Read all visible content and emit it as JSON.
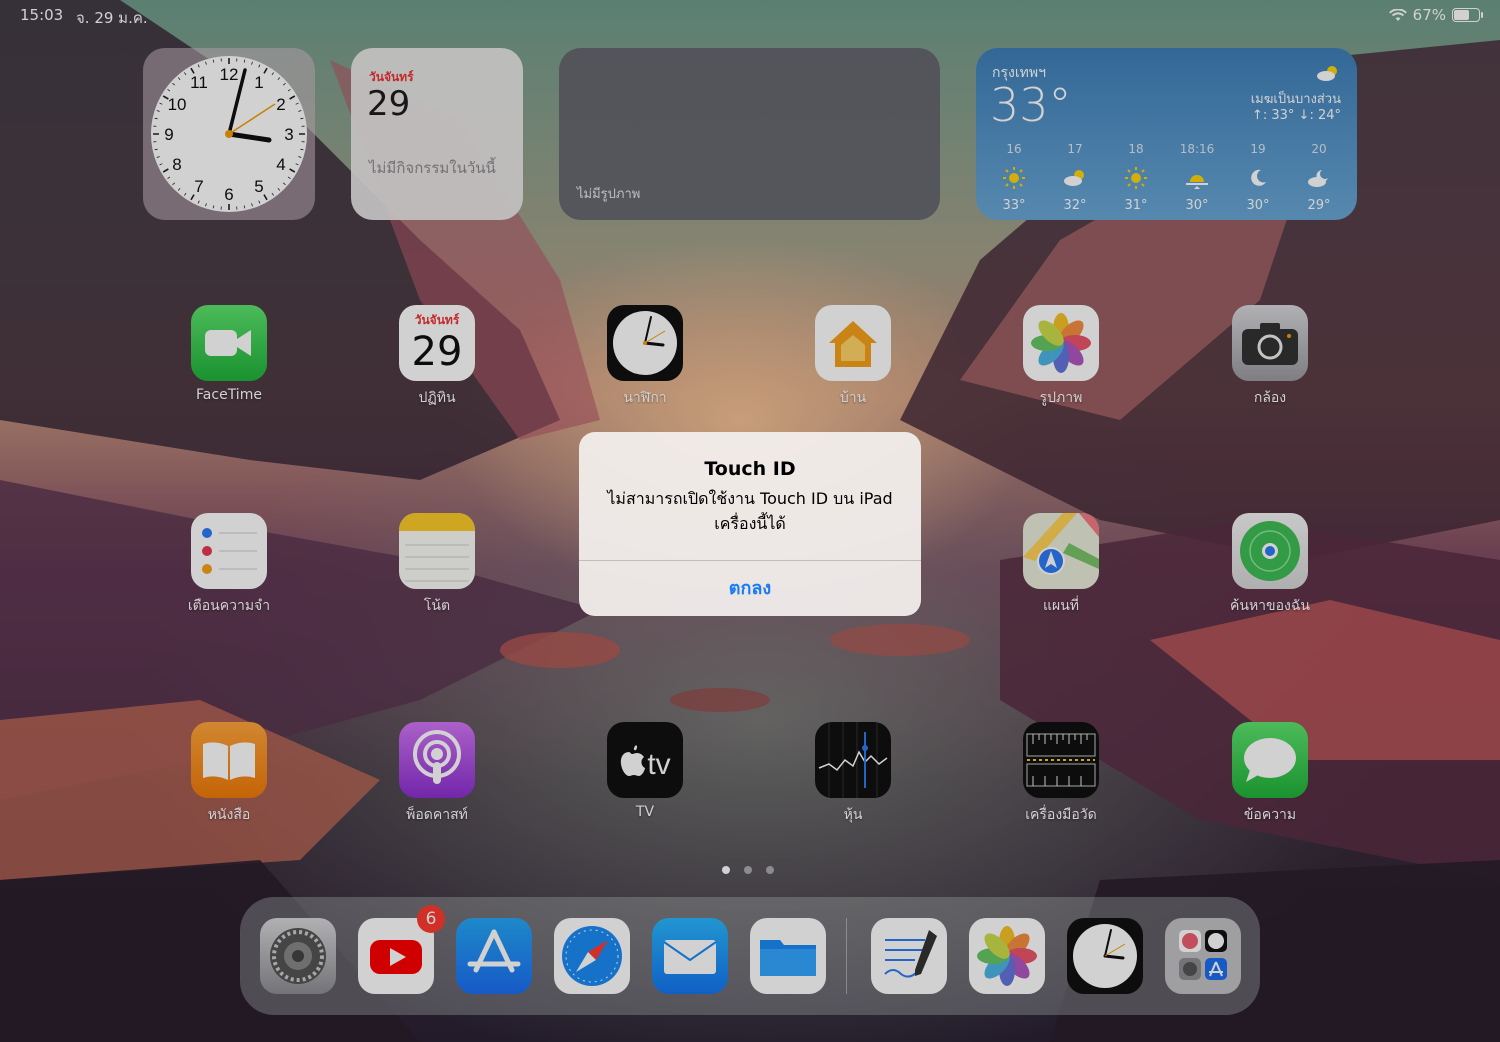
{
  "status_bar": {
    "time": "15:03",
    "date": "จ. 29 ม.ค.",
    "battery": "67%",
    "battery_level": 0.67
  },
  "widgets": {
    "clock": {
      "numbers": [
        "12",
        "1",
        "2",
        "3",
        "4",
        "5",
        "6",
        "7",
        "8",
        "9",
        "10",
        "11"
      ]
    },
    "calendar": {
      "day": "วันจันทร์",
      "date": "29",
      "no_events": "ไม่มีกิจกรรมในวันนี้"
    },
    "photos": {
      "empty_text": "ไม่มีรูปภาพ"
    },
    "weather": {
      "city": "กรุงเทพฯ",
      "temp": "33°",
      "condition": "เมฆเป็นบางส่วน",
      "high_low": "↑: 33° ↓: 24°",
      "hours": [
        {
          "time": "16",
          "icon": "sun-icon",
          "temp": "33°"
        },
        {
          "time": "17",
          "icon": "partly-cloudy-icon",
          "temp": "32°"
        },
        {
          "time": "18",
          "icon": "sun-icon",
          "temp": "31°"
        },
        {
          "time": "18:16",
          "icon": "sunset-icon",
          "temp": "30°"
        },
        {
          "time": "19",
          "icon": "moon-icon",
          "temp": "30°"
        },
        {
          "time": "20",
          "icon": "partly-cloudy-night-icon",
          "temp": "29°"
        }
      ]
    }
  },
  "apps": [
    {
      "label": "FaceTime",
      "icon": "facetime-icon"
    },
    {
      "label": "ปฏิทิน",
      "icon": "calendar-icon",
      "day": "วันจันทร์",
      "date": "29"
    },
    {
      "label": "นาฬิกา",
      "icon": "clock-icon"
    },
    {
      "label": "บ้าน",
      "icon": "home-icon"
    },
    {
      "label": "รูปภาพ",
      "icon": "photos-icon"
    },
    {
      "label": "กล้อง",
      "icon": "camera-icon"
    },
    {
      "label": "เตือนความจำ",
      "icon": "reminders-icon"
    },
    {
      "label": "โน้ต",
      "icon": "notes-icon"
    },
    {
      "label": "แผนที่",
      "icon": "maps-icon"
    },
    {
      "label": "ค้นหาของฉัน",
      "icon": "find-my-icon"
    },
    {
      "label": "หนังสือ",
      "icon": "books-icon"
    },
    {
      "label": "พ็อดคาสท์",
      "icon": "podcasts-icon"
    },
    {
      "label": "TV",
      "icon": "tv-icon",
      "glyph": "tv"
    },
    {
      "label": "หุ้น",
      "icon": "stocks-icon"
    },
    {
      "label": "เครื่องมือวัด",
      "icon": "measure-icon"
    },
    {
      "label": "ข้อความ",
      "icon": "messages-icon"
    }
  ],
  "dock": {
    "items": [
      "settings-icon",
      "youtube-icon",
      "app-store-icon",
      "safari-icon",
      "mail-icon",
      "files-icon",
      "freeform-icon",
      "photos-icon",
      "clock-icon",
      "app-library-icon"
    ],
    "youtube_badge": "6"
  },
  "alert": {
    "title": "Touch ID",
    "message_line1": "ไม่สามารถเปิดใช้งาน Touch ID บน iPad",
    "message_line2": "เครื่องนี้ได้",
    "button": "ตกลง"
  },
  "colors": {
    "alert_button": "#1a7cf5",
    "badge": "#ff3b30",
    "weather_bg": "#3f7fb8"
  }
}
